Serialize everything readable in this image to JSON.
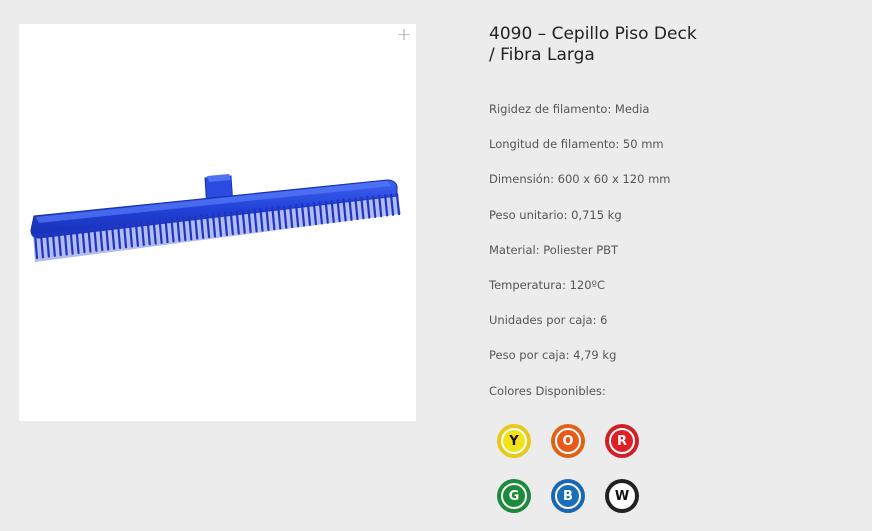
{
  "product": {
    "title_line1": "4090 – Cepillo Piso Deck",
    "title_line2": "/ Fibra Larga",
    "zoom_icon": "+",
    "image_icon": "broom-image"
  },
  "specs": [
    "Rigidez de filamento: Media",
    "Longitud de filamento: 50 mm",
    "Dimensión: 600 x 60 x 120 mm",
    "Peso unitario: 0,715 kg",
    "Material: Poliester PBT",
    "Temperatura: 120ºC",
    "Unidades por caja: 6",
    "Peso por caja: 4,79 kg",
    "Colores Disponibles:"
  ],
  "colors": [
    {
      "letter": "Y",
      "bg": "#f2e318",
      "ring": "#e9c81a",
      "text": "#111111"
    },
    {
      "letter": "O",
      "bg": "#e85a1c",
      "ring": "#e06217",
      "text": "#ffffff"
    },
    {
      "letter": "R",
      "bg": "#de1f26",
      "ring": "#d01f26",
      "text": "#ffffff"
    },
    {
      "letter": "G",
      "bg": "#1a8c3a",
      "ring": "#1c8a3a",
      "text": "#ffffff"
    },
    {
      "letter": "B",
      "bg": "#1b6fb8",
      "ring": "#1a66b0",
      "text": "#ffffff"
    },
    {
      "letter": "W",
      "bg": "#ffffff",
      "ring": "#222222",
      "text": "#111111"
    }
  ],
  "theme": {
    "page_bg": "#ececec",
    "brush_blue": "#1f3fd6"
  }
}
